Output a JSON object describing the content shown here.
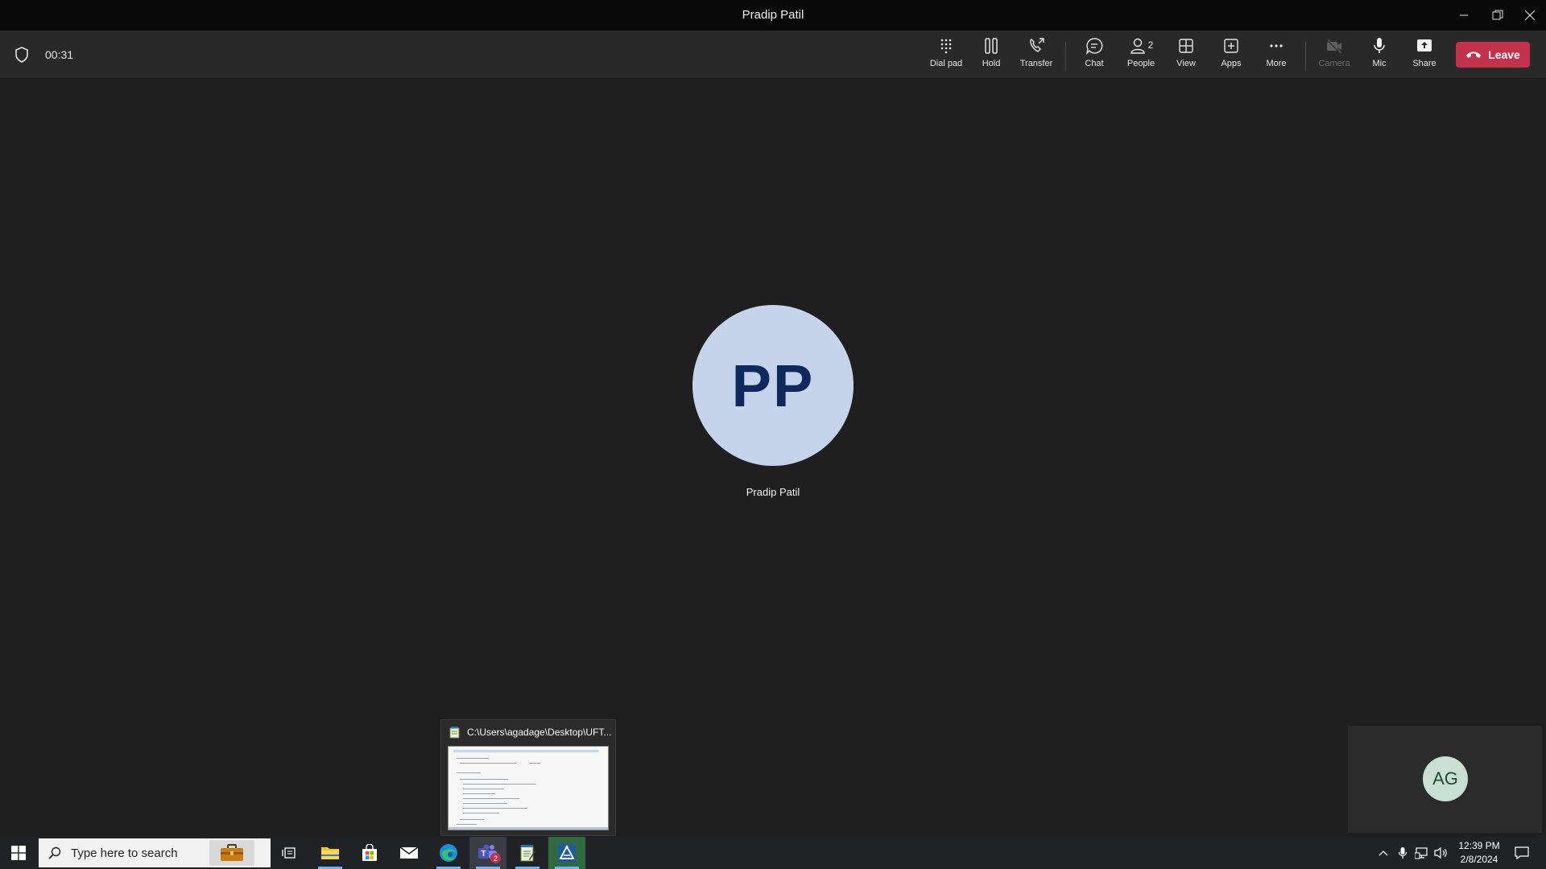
{
  "window": {
    "title": "Pradip Patil"
  },
  "call": {
    "duration": "00:31"
  },
  "toolbar": {
    "dialpad": "Dial pad",
    "hold": "Hold",
    "transfer": "Transfer",
    "chat": "Chat",
    "people": "People",
    "people_count": "2",
    "view": "View",
    "apps": "Apps",
    "more": "More",
    "camera": "Camera",
    "mic": "Mic",
    "share": "Share",
    "leave": "Leave"
  },
  "participant": {
    "initials": "PP",
    "name": "Pradip Patil"
  },
  "self": {
    "initials": "AG"
  },
  "preview": {
    "title": "C:\\Users\\agadage\\Desktop\\UFT..."
  },
  "taskbar": {
    "search_placeholder": "Type here to search",
    "teams_badge": "2",
    "time": "12:39 PM",
    "date": "2/8/2024"
  },
  "colors": {
    "leave": "#c4314b",
    "avatar_bg": "#c5d4eb",
    "avatar_fg": "#0e2a5c",
    "accent_underline": "#6fb5f5"
  }
}
